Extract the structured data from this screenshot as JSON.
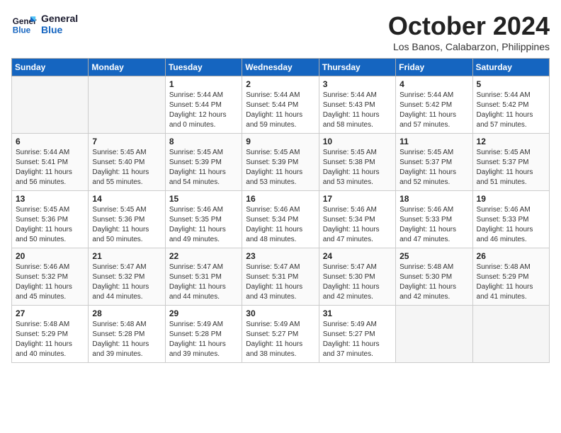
{
  "header": {
    "logo_line1": "General",
    "logo_line2": "Blue",
    "month_title": "October 2024",
    "location": "Los Banos, Calabarzon, Philippines"
  },
  "days_of_week": [
    "Sunday",
    "Monday",
    "Tuesday",
    "Wednesday",
    "Thursday",
    "Friday",
    "Saturday"
  ],
  "weeks": [
    [
      {
        "day": "",
        "text": ""
      },
      {
        "day": "",
        "text": ""
      },
      {
        "day": "1",
        "text": "Sunrise: 5:44 AM\nSunset: 5:44 PM\nDaylight: 12 hours and 0 minutes."
      },
      {
        "day": "2",
        "text": "Sunrise: 5:44 AM\nSunset: 5:44 PM\nDaylight: 11 hours and 59 minutes."
      },
      {
        "day": "3",
        "text": "Sunrise: 5:44 AM\nSunset: 5:43 PM\nDaylight: 11 hours and 58 minutes."
      },
      {
        "day": "4",
        "text": "Sunrise: 5:44 AM\nSunset: 5:42 PM\nDaylight: 11 hours and 57 minutes."
      },
      {
        "day": "5",
        "text": "Sunrise: 5:44 AM\nSunset: 5:42 PM\nDaylight: 11 hours and 57 minutes."
      }
    ],
    [
      {
        "day": "6",
        "text": "Sunrise: 5:44 AM\nSunset: 5:41 PM\nDaylight: 11 hours and 56 minutes."
      },
      {
        "day": "7",
        "text": "Sunrise: 5:45 AM\nSunset: 5:40 PM\nDaylight: 11 hours and 55 minutes."
      },
      {
        "day": "8",
        "text": "Sunrise: 5:45 AM\nSunset: 5:39 PM\nDaylight: 11 hours and 54 minutes."
      },
      {
        "day": "9",
        "text": "Sunrise: 5:45 AM\nSunset: 5:39 PM\nDaylight: 11 hours and 53 minutes."
      },
      {
        "day": "10",
        "text": "Sunrise: 5:45 AM\nSunset: 5:38 PM\nDaylight: 11 hours and 53 minutes."
      },
      {
        "day": "11",
        "text": "Sunrise: 5:45 AM\nSunset: 5:37 PM\nDaylight: 11 hours and 52 minutes."
      },
      {
        "day": "12",
        "text": "Sunrise: 5:45 AM\nSunset: 5:37 PM\nDaylight: 11 hours and 51 minutes."
      }
    ],
    [
      {
        "day": "13",
        "text": "Sunrise: 5:45 AM\nSunset: 5:36 PM\nDaylight: 11 hours and 50 minutes."
      },
      {
        "day": "14",
        "text": "Sunrise: 5:45 AM\nSunset: 5:36 PM\nDaylight: 11 hours and 50 minutes."
      },
      {
        "day": "15",
        "text": "Sunrise: 5:46 AM\nSunset: 5:35 PM\nDaylight: 11 hours and 49 minutes."
      },
      {
        "day": "16",
        "text": "Sunrise: 5:46 AM\nSunset: 5:34 PM\nDaylight: 11 hours and 48 minutes."
      },
      {
        "day": "17",
        "text": "Sunrise: 5:46 AM\nSunset: 5:34 PM\nDaylight: 11 hours and 47 minutes."
      },
      {
        "day": "18",
        "text": "Sunrise: 5:46 AM\nSunset: 5:33 PM\nDaylight: 11 hours and 47 minutes."
      },
      {
        "day": "19",
        "text": "Sunrise: 5:46 AM\nSunset: 5:33 PM\nDaylight: 11 hours and 46 minutes."
      }
    ],
    [
      {
        "day": "20",
        "text": "Sunrise: 5:46 AM\nSunset: 5:32 PM\nDaylight: 11 hours and 45 minutes."
      },
      {
        "day": "21",
        "text": "Sunrise: 5:47 AM\nSunset: 5:32 PM\nDaylight: 11 hours and 44 minutes."
      },
      {
        "day": "22",
        "text": "Sunrise: 5:47 AM\nSunset: 5:31 PM\nDaylight: 11 hours and 44 minutes."
      },
      {
        "day": "23",
        "text": "Sunrise: 5:47 AM\nSunset: 5:31 PM\nDaylight: 11 hours and 43 minutes."
      },
      {
        "day": "24",
        "text": "Sunrise: 5:47 AM\nSunset: 5:30 PM\nDaylight: 11 hours and 42 minutes."
      },
      {
        "day": "25",
        "text": "Sunrise: 5:48 AM\nSunset: 5:30 PM\nDaylight: 11 hours and 42 minutes."
      },
      {
        "day": "26",
        "text": "Sunrise: 5:48 AM\nSunset: 5:29 PM\nDaylight: 11 hours and 41 minutes."
      }
    ],
    [
      {
        "day": "27",
        "text": "Sunrise: 5:48 AM\nSunset: 5:29 PM\nDaylight: 11 hours and 40 minutes."
      },
      {
        "day": "28",
        "text": "Sunrise: 5:48 AM\nSunset: 5:28 PM\nDaylight: 11 hours and 39 minutes."
      },
      {
        "day": "29",
        "text": "Sunrise: 5:49 AM\nSunset: 5:28 PM\nDaylight: 11 hours and 39 minutes."
      },
      {
        "day": "30",
        "text": "Sunrise: 5:49 AM\nSunset: 5:27 PM\nDaylight: 11 hours and 38 minutes."
      },
      {
        "day": "31",
        "text": "Sunrise: 5:49 AM\nSunset: 5:27 PM\nDaylight: 11 hours and 37 minutes."
      },
      {
        "day": "",
        "text": ""
      },
      {
        "day": "",
        "text": ""
      }
    ]
  ]
}
